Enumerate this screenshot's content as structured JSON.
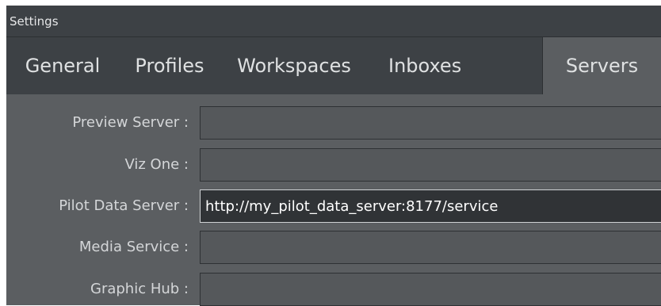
{
  "window": {
    "title": "Settings"
  },
  "tabs": [
    {
      "label": "General"
    },
    {
      "label": "Profiles"
    },
    {
      "label": "Workspaces"
    },
    {
      "label": "Inboxes"
    },
    {
      "label": "Servers",
      "active": true
    }
  ],
  "servers": {
    "preview_server": {
      "label": "Preview Server :",
      "value": ""
    },
    "viz_one": {
      "label": "Viz One :",
      "value": ""
    },
    "pilot_data_server": {
      "label": "Pilot Data Server :",
      "value": "http://my_pilot_data_server:8177/service"
    },
    "media_service": {
      "label": "Media Service :",
      "value": ""
    },
    "graphic_hub": {
      "label": "Graphic Hub :",
      "value": ""
    }
  },
  "colors": {
    "titlebar_bg": "#3d4145",
    "panel_bg": "#5b5e61",
    "field_bg": "#55585b",
    "focused_field_bg": "#303336",
    "text": "#dfe1e2"
  }
}
